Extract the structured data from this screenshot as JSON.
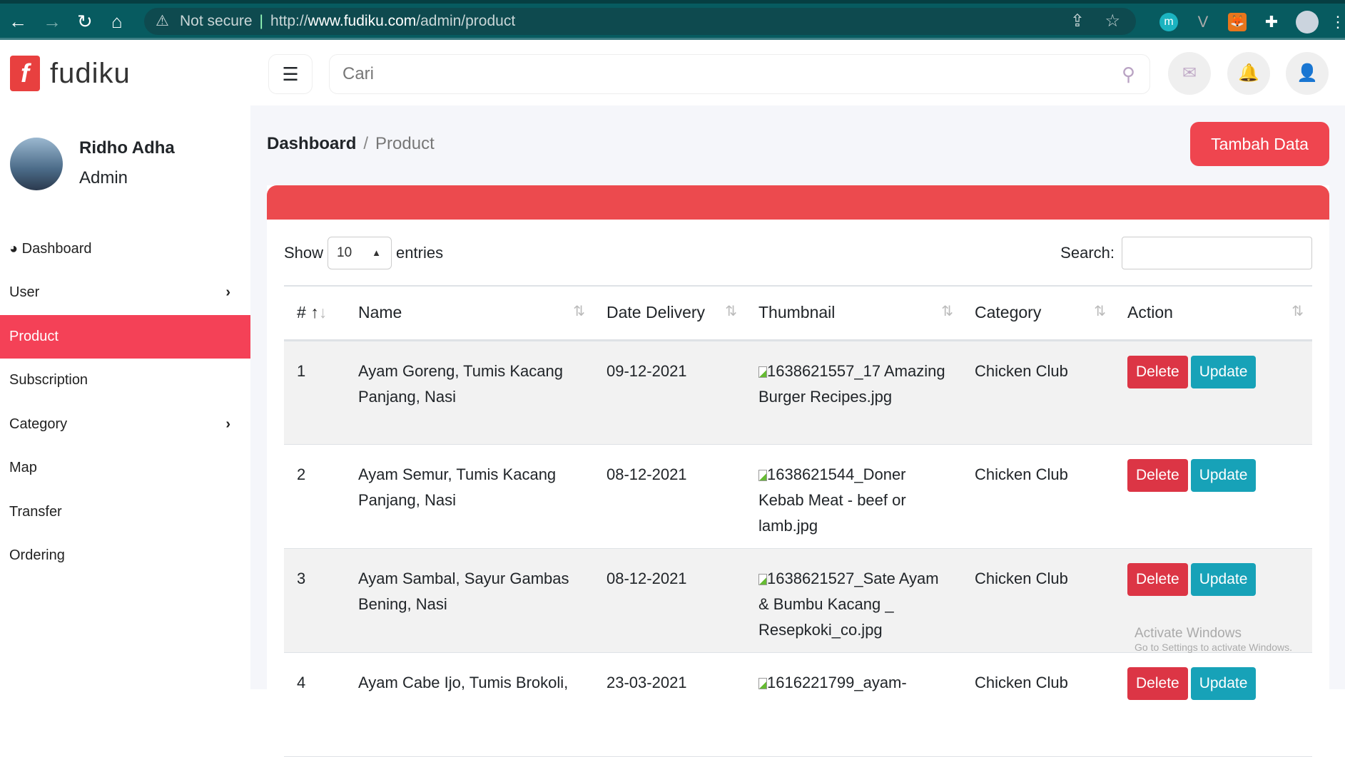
{
  "browser": {
    "security": "Not secure",
    "url_prefix": "http://",
    "url_host": "www.fudiku.com",
    "url_path": "/admin/product"
  },
  "brand": {
    "name": "fudiku",
    "logo_letter": "f"
  },
  "header": {
    "search_placeholder": "Cari"
  },
  "user": {
    "name": "Ridho Adha",
    "role": "Admin"
  },
  "sidebar": {
    "items": [
      {
        "label": "Dashboard"
      },
      {
        "label": "User"
      },
      {
        "label": "Product"
      },
      {
        "label": "Subscription"
      },
      {
        "label": "Category"
      },
      {
        "label": "Map"
      },
      {
        "label": "Transfer"
      },
      {
        "label": "Ordering"
      }
    ]
  },
  "breadcrumb": {
    "root": "Dashboard",
    "current": "Product"
  },
  "add_button": "Tambah Data",
  "table_controls": {
    "show": "Show",
    "entries_value": "10",
    "entries": "entries",
    "search": "Search:"
  },
  "table": {
    "headers": [
      "#",
      "Name",
      "Date Delivery",
      "Thumbnail",
      "Category",
      "Action"
    ],
    "rows": [
      {
        "no": "1",
        "name": "Ayam Goreng, Tumis Kacang Panjang, Nasi",
        "date": "09-12-2021",
        "thumb": "1638621557_17 Amazing Burger Recipes.jpg",
        "category": "Chicken Club"
      },
      {
        "no": "2",
        "name": "Ayam Semur, Tumis Kacang Panjang, Nasi",
        "date": "08-12-2021",
        "thumb": "1638621544_Doner Kebab Meat - beef or lamb.jpg",
        "category": "Chicken Club"
      },
      {
        "no": "3",
        "name": "Ayam Sambal, Sayur Gambas Bening, Nasi",
        "date": "08-12-2021",
        "thumb": "1638621527_Sate Ayam & Bumbu Kacang _ Resepkoki_co.jpg",
        "category": "Chicken Club"
      },
      {
        "no": "4",
        "name": "Ayam Cabe Ijo, Tumis Brokoli,",
        "date": "23-03-2021",
        "thumb": "1616221799_ayam-",
        "category": "Chicken Club"
      }
    ],
    "delete": "Delete",
    "update": "Update"
  },
  "watermark": {
    "title": "Activate Windows",
    "sub": "Go to Settings to activate Windows."
  }
}
